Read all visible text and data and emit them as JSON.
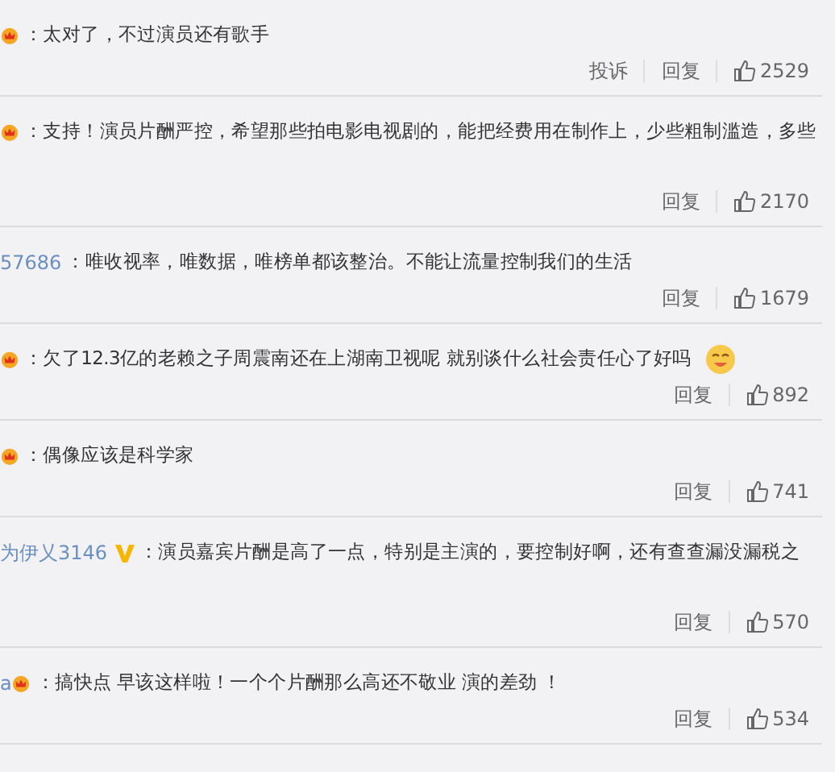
{
  "comments": [
    {
      "crown": true,
      "verified": false,
      "text": "：太对了，不过演员还有歌手",
      "tall": false,
      "actions": [
        "投诉",
        "回复"
      ],
      "likes": "2529"
    },
    {
      "crown": true,
      "verified": false,
      "text": "：支持！演员片酬严控，希望那些拍电影电视剧的，能把经费用在制作上，少些粗制滥造，多些",
      "tall": true,
      "actions": [
        "回复"
      ],
      "likes": "2170"
    },
    {
      "username": "57686",
      "crown": false,
      "verified": false,
      "text": "：唯收视率，唯数据，唯榜单都该整治。不能让流量控制我们的生活",
      "tall": false,
      "actions": [
        "回复"
      ],
      "likes": "1679"
    },
    {
      "crown": true,
      "verified": false,
      "text": "：欠了12.3亿的老赖之子周震南还在上湖南卫视呢 就别谈什么社会责任心了好吗",
      "emoji": true,
      "tall": false,
      "actions": [
        "回复"
      ],
      "likes": "892"
    },
    {
      "crown": true,
      "verified": false,
      "text": "：偶像应该是科学家",
      "tall": false,
      "actions": [
        "回复"
      ],
      "likes": "741"
    },
    {
      "username": "为伊乂3146",
      "crown": false,
      "verified": true,
      "text": "：演员嘉宾片酬是高了一点，特别是主演的，要控制好啊，还有查查漏没漏税之",
      "tall": true,
      "actions": [
        "回复"
      ],
      "likes": "570"
    },
    {
      "username": "a",
      "crown": true,
      "verified": false,
      "text": "：搞快点 早该这样啦！一个个片酬那么高还不敬业 演的差劲 ！",
      "tall": false,
      "actions": [
        "回复"
      ],
      "likes": "534"
    }
  ]
}
